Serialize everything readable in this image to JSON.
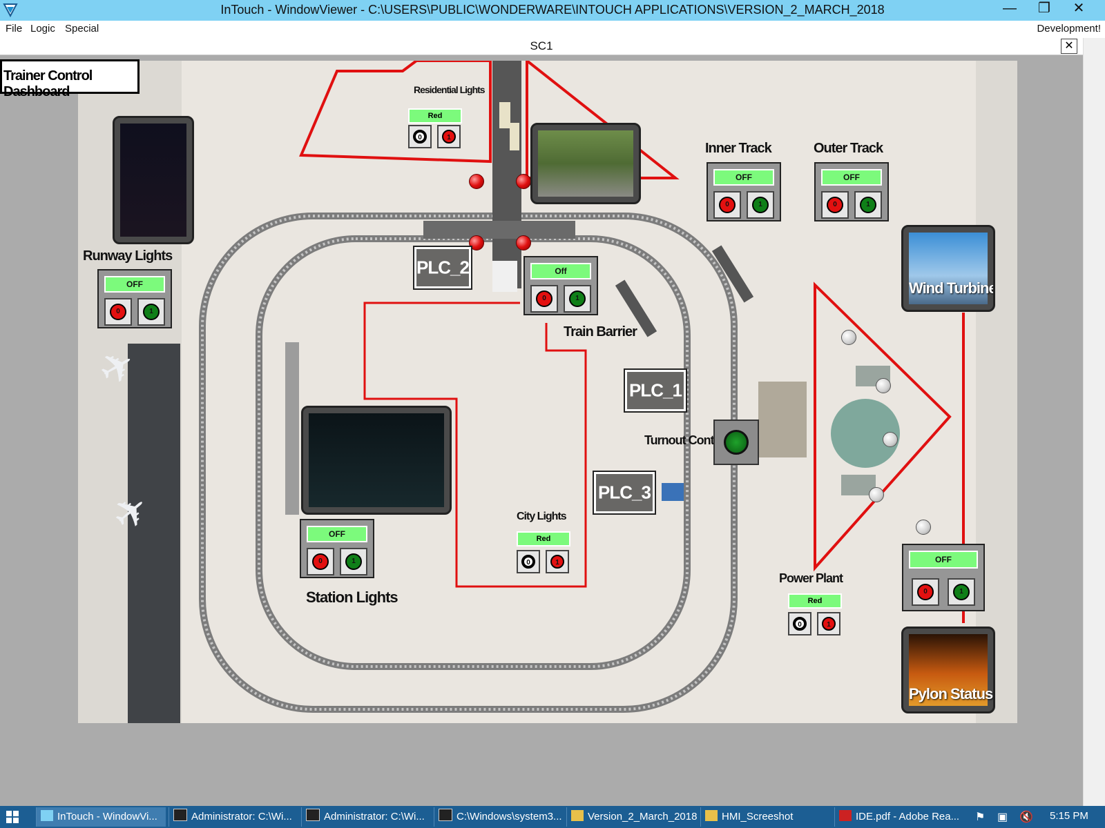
{
  "window": {
    "title": "InTouch - WindowViewer - C:\\USERS\\PUBLIC\\WONDERWARE\\INTOUCH APPLICATIONS\\VERSION_2_MARCH_2018",
    "minimize": "—",
    "restore": "❐",
    "close": "✕"
  },
  "menu": {
    "file": "File",
    "logic": "Logic",
    "special": "Special",
    "mode": "Development!"
  },
  "document": {
    "name": "SC1",
    "close": "✕"
  },
  "dashboard": {
    "title": "Trainer Control Dashboard"
  },
  "residential": {
    "label": "Residential Lights",
    "status": "Red",
    "btn0": "0",
    "btn1": "1"
  },
  "inner_track": {
    "label": "Inner Track",
    "status": "OFF",
    "btn0": "0",
    "btn1": "1"
  },
  "outer_track": {
    "label": "Outer Track",
    "status": "OFF",
    "btn0": "0",
    "btn1": "1"
  },
  "runway": {
    "label": "Runway Lights",
    "status": "OFF",
    "btn0": "0",
    "btn1": "1"
  },
  "train_barrier": {
    "label": "Train Barrier",
    "status": "Off",
    "btn0": "0",
    "btn1": "1"
  },
  "station": {
    "label": "Station Lights",
    "status": "OFF",
    "btn0": "0",
    "btn1": "1"
  },
  "city": {
    "label": "City Lights",
    "status": "Red",
    "btn0": "0",
    "btn1": "1"
  },
  "power_plant": {
    "label": "Power Plant",
    "status": "Red",
    "btn0": "0",
    "btn1": "1"
  },
  "pylon_ctrl": {
    "status": "OFF",
    "btn0": "0",
    "btn1": "1"
  },
  "turnout": {
    "label": "Turnout Control"
  },
  "plcs": {
    "plc1": "PLC_1",
    "plc2": "PLC_2",
    "plc3": "PLC_3"
  },
  "cams": {
    "wind": "Wind Turbine",
    "pylon": "Pylon Status"
  },
  "colors": {
    "indicator_green": "#7cfa7c",
    "btn_red": "#e31010",
    "btn_green": "#0f7f18",
    "outline_red": "#e01010",
    "titlebar": "#7fd1f3",
    "taskbar": "#1c5e93"
  },
  "taskbar": {
    "items": [
      "InTouch - WindowVi...",
      "Administrator: C:\\Wi...",
      "Administrator: C:\\Wi...",
      "C:\\Windows\\system3...",
      "Version_2_March_2018",
      "HMI_Screeshot",
      "IDE.pdf - Adobe Rea..."
    ],
    "clock": "5:15 PM"
  }
}
